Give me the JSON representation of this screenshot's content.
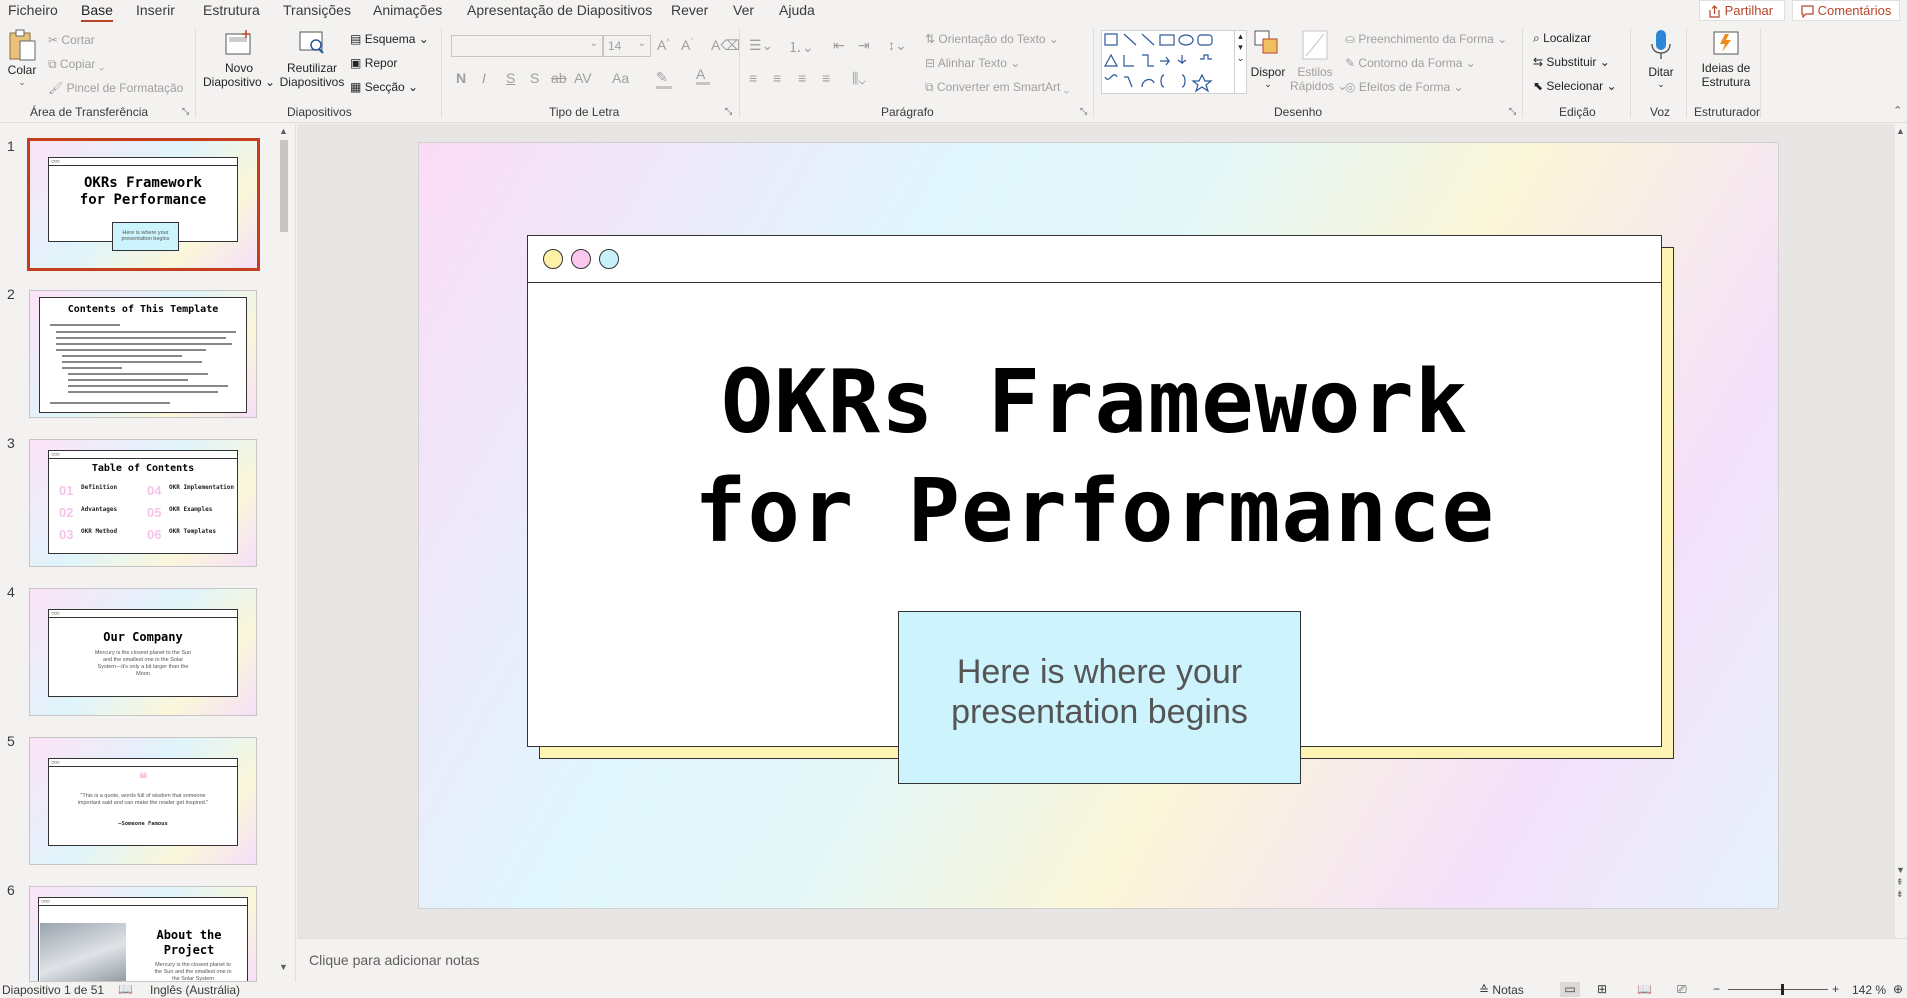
{
  "menu": {
    "tabs": [
      "Ficheiro",
      "Base",
      "Inserir",
      "Estrutura",
      "Transições",
      "Animações",
      "Apresentação de Diapositivos",
      "Rever",
      "Ver",
      "Ajuda"
    ],
    "active_tab": "Base",
    "share_label": "Partilhar",
    "comments_label": "Comentários"
  },
  "ribbon": {
    "clipboard": {
      "paste": "Colar",
      "cut": "Cortar",
      "copy": "Copiar",
      "format_painter": "Pincel de Formatação",
      "group_label": "Área de Transferência"
    },
    "slides": {
      "new_slide_line1": "Novo",
      "new_slide_line2": "Diapositivo",
      "reuse_line1": "Reutilizar",
      "reuse_line2": "Diapositivos",
      "layout": "Esquema",
      "reset": "Repor",
      "section": "Secção",
      "group_label": "Diapositivos"
    },
    "font": {
      "font_name": "",
      "font_size": "14",
      "group_label": "Tipo de Letra",
      "bold": "N",
      "italic": "I",
      "underline": "S",
      "shadow": "S",
      "strike": "ab",
      "spacing": "AV",
      "case": "Aa"
    },
    "paragraph": {
      "text_direction": "Orientação do Texto",
      "align_text": "Alinhar Texto",
      "smartart": "Converter em SmartArt",
      "group_label": "Parágrafo"
    },
    "drawing": {
      "arrange": "Dispor",
      "quick_styles_line1": "Estilos",
      "quick_styles_line2": "Rápidos",
      "shape_fill": "Preenchimento da Forma",
      "shape_outline": "Contorno da Forma",
      "shape_effects": "Efeitos de Forma",
      "group_label": "Desenho"
    },
    "editing": {
      "find": "Localizar",
      "replace": "Substituir",
      "select": "Selecionar",
      "group_label": "Edição"
    },
    "voice": {
      "dictate": "Ditar",
      "group_label": "Voz"
    },
    "designer": {
      "ideas_line1": "Ideias de",
      "ideas_line2": "Estrutura",
      "group_label": "Estruturador"
    }
  },
  "thumbnails": [
    {
      "num": "1",
      "title_line1": "OKRs Framework",
      "title_line2": "for Performance",
      "subtitle": "Here is where your presentation begins"
    },
    {
      "num": "2",
      "title": "Contents of This Template"
    },
    {
      "num": "3",
      "title": "Table of Contents",
      "items": [
        {
          "n": "01",
          "label": "Definition"
        },
        {
          "n": "04",
          "label": "OKR Implementation"
        },
        {
          "n": "02",
          "label": "Advantages"
        },
        {
          "n": "05",
          "label": "OKR Examples"
        },
        {
          "n": "03",
          "label": "OKR Method"
        },
        {
          "n": "06",
          "label": "OKR Templates"
        }
      ]
    },
    {
      "num": "4",
      "title": "Our Company",
      "body": "Mercury is the closest planet to the Sun and the smallest one in the Solar System—it's only a bit larger than the Moon"
    },
    {
      "num": "5",
      "quote": "\"This is a quote, words full of wisdom that someone important said and can make the reader get inspired.\"",
      "author": "—Someone Famous"
    },
    {
      "num": "6",
      "title_line1": "About the",
      "title_line2": "Project",
      "body": "Mercury is the closest planet to the Sun and the smallest one in the Solar System"
    }
  ],
  "slide": {
    "title_line1": "OKRs Framework",
    "title_line2": "for Performance",
    "subtitle_line1": "Here is where your",
    "subtitle_line2": "presentation begins",
    "dot_colors": [
      "#fdf1a8",
      "#fbc8ee",
      "#c7f1fb"
    ],
    "shadow_color": "#fdf3b3",
    "subtitle_bg": "#cdf4fc"
  },
  "notes_placeholder": "Clique para adicionar notas",
  "status": {
    "slide_counter": "Diapositivo 1 de 51",
    "language": "Inglês (Austrália)",
    "notes": "Notas",
    "zoom": "142 %"
  },
  "colors": {
    "accent": "#b7472a",
    "selection": "#c43e1c"
  }
}
